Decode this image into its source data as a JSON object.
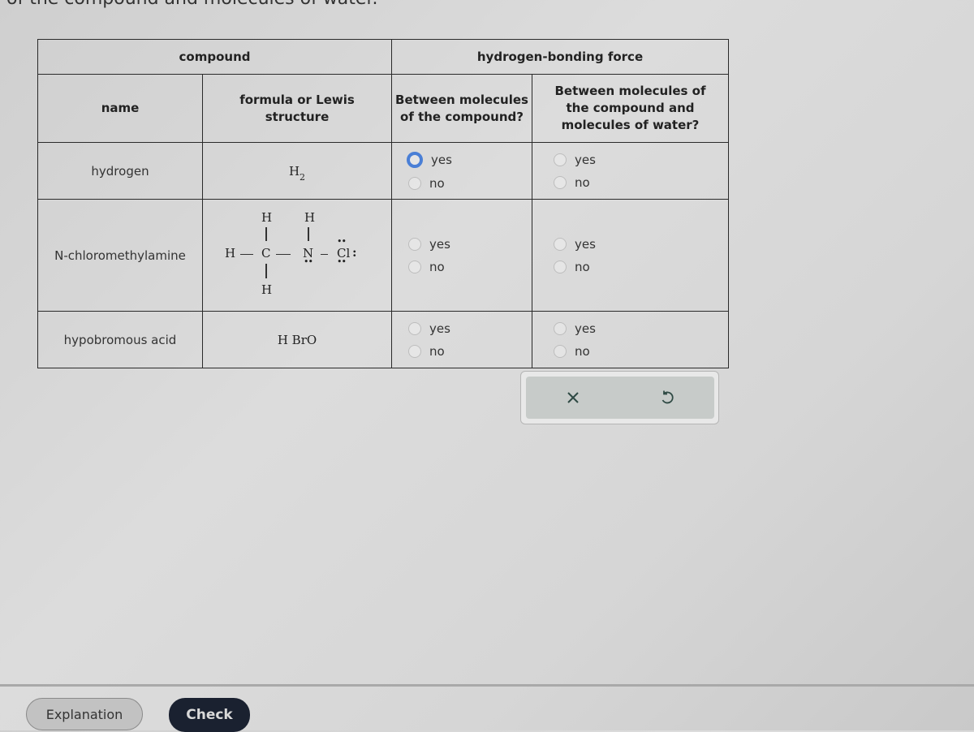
{
  "question_tail": "of the compound and molecules of water.",
  "table": {
    "group_headers": {
      "compound": "compound",
      "hbond": "hydrogen-bonding force"
    },
    "sub_headers": {
      "name": "name",
      "formula": "formula or Lewis structure",
      "between_compound": "Between molecules of the compound?",
      "between_water": "Between molecules of the compound and molecules of water?"
    },
    "rows": [
      {
        "name": "hydrogen",
        "formula": "H",
        "formula_subscript": "2",
        "between_compound": {
          "options": [
            "yes",
            "no"
          ],
          "selected": null,
          "focused": "yes"
        },
        "between_water": {
          "options": [
            "yes",
            "no"
          ],
          "selected": null
        }
      },
      {
        "name": "N-chloromethylamine",
        "lewis": {
          "atoms": {
            "h_top_c": "H",
            "h_top_n": "H",
            "h_left": "H",
            "c": "C",
            "n": "N",
            "cl": "Cl",
            "h_bottom": "H"
          },
          "lone_pair_marks": {
            "cl_top": "••",
            "cl_right": ":",
            "cl_bottom": "••",
            "n_bottom": "••"
          }
        },
        "between_compound": {
          "options": [
            "yes",
            "no"
          ],
          "selected": null
        },
        "between_water": {
          "options": [
            "yes",
            "no"
          ],
          "selected": null
        }
      },
      {
        "name": "hypobromous acid",
        "formula": "H BrO",
        "between_compound": {
          "options": [
            "yes",
            "no"
          ],
          "selected": null
        },
        "between_water": {
          "options": [
            "yes",
            "no"
          ],
          "selected": null
        }
      }
    ]
  },
  "actions": {
    "clear_icon": "x-icon",
    "reset_icon": "undo-icon"
  },
  "buttons": {
    "explanation": "Explanation",
    "check": "Check"
  }
}
